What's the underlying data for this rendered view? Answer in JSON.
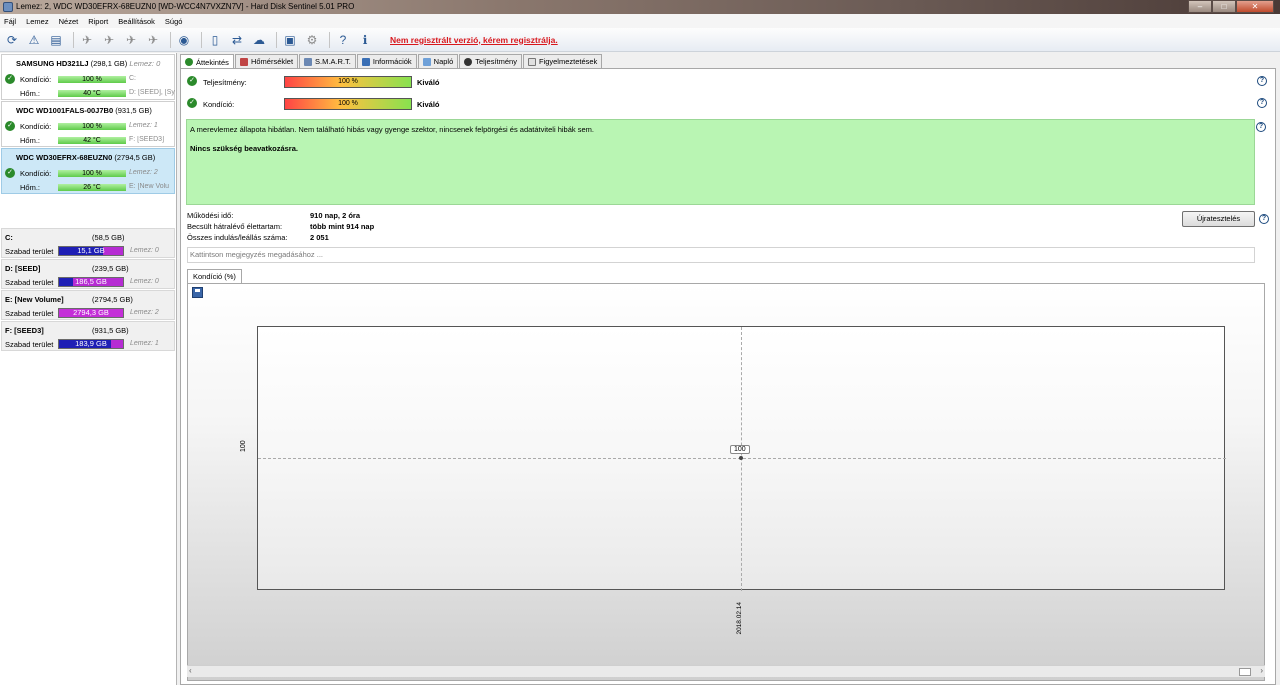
{
  "window": {
    "title": "Lemez: 2, WDC WD30EFRX-68EUZN0 [WD-WCC4N7VXZN7V]  -  Hard Disk Sentinel 5.01 PRO",
    "buttons": [
      "–",
      "□",
      "✕"
    ]
  },
  "menu": [
    "Fájl",
    "Lemez",
    "Nézet",
    "Riport",
    "Beállítások",
    "Súgó"
  ],
  "toolbar": {
    "icons": [
      "refresh-icon",
      "warning-icon",
      "report-icon",
      "satellite-icon",
      "satellite-icon",
      "satellite-icon",
      "satellite-icon",
      "globe-icon",
      "document-icon",
      "sync-icon",
      "cloud-icon",
      "benchmark-icon",
      "settings-icon",
      "help-icon",
      "info-icon"
    ],
    "register_text": "Nem regisztrált verzió, kérem regisztrálja."
  },
  "disks": [
    {
      "name": "SAMSUNG HD321LJ",
      "size": "(298,1 GB)",
      "note": "Lemez: 0",
      "condition_label": "Kondíció:",
      "condition": "100 %",
      "condition_side": "C:",
      "temp_label": "Hőm.:",
      "temp": "40 °C",
      "temp_side": "D: [SEED], [Sy"
    },
    {
      "name": "WDC WD1001FALS-00J7B0",
      "size": "(931,5 GB)",
      "note": "",
      "condition_label": "Kondíció:",
      "condition": "100 %",
      "condition_side": "Lemez: 1",
      "temp_label": "Hőm.:",
      "temp": "42 °C",
      "temp_side": "F: [SEED3]"
    },
    {
      "name": "WDC WD30EFRX-68EUZN0",
      "size": "(2794,5 GB)",
      "note": "",
      "condition_label": "Kondíció:",
      "condition": "100 %",
      "condition_side": "Lemez: 2",
      "temp_label": "Hőm.:",
      "temp": "26 °C",
      "temp_side": "E: [New Volu"
    }
  ],
  "volumes": [
    {
      "name": "C:",
      "size": "(58,5 GB)",
      "free_label": "Szabad terület",
      "free": "15,1 GB",
      "free_pct": 0.26,
      "note": "Lemez: 0"
    },
    {
      "name": "D: [SEED]",
      "size": "(239,5 GB)",
      "free_label": "Szabad terület",
      "free": "186,5 GB",
      "free_pct": 0.78,
      "note": "Lemez: 0"
    },
    {
      "name": "E: [New Volume]",
      "size": "(2794,5 GB)",
      "free_label": "Szabad terület",
      "free": "2794,3 GB",
      "free_pct": 1.0,
      "note": "Lemez: 2"
    },
    {
      "name": "F: [SEED3]",
      "size": "(931,5 GB)",
      "free_label": "Szabad terület",
      "free": "183,9 GB",
      "free_pct": 0.2,
      "note": "Lemez: 1"
    }
  ],
  "tabs": [
    "Áttekintés",
    "Hőmérséklet",
    "S.M.A.R.T.",
    "Információk",
    "Napló",
    "Teljesítmény",
    "Figyelmeztetések"
  ],
  "overview": {
    "performance_label": "Teljesítmény:",
    "performance_value": "100 %",
    "performance_status": "Kiváló",
    "condition_label": "Kondíció:",
    "condition_value": "100 %",
    "condition_status": "Kiváló",
    "status_text": "A merevlemez állapota hibátlan. Nem található hibás vagy gyenge szektor, nincsenek felpörgési és adatátviteli hibák sem.",
    "recommendation": "Nincs szükség beavatkozásra.",
    "uptime_label": "Működési idő:",
    "uptime_value": "910 nap, 2 óra",
    "remaining_label": "Becsült hátralévő élettartam:",
    "remaining_value": "több mint 914 nap",
    "startstop_label": "Összes indulás/leállás száma:",
    "startstop_value": "2 051",
    "retest_button": "Újratesztelés",
    "note_placeholder": "Kattintson megjegyzés megadásához ...",
    "help_icon": "?"
  },
  "chart_tab": "Kondíció  (%)",
  "chart_data": {
    "type": "line",
    "title": "",
    "xlabel": "",
    "ylabel": "",
    "x": [
      "2018.02.14"
    ],
    "series": [
      {
        "values": [
          100
        ]
      }
    ],
    "ytick": "100",
    "point_label": "100",
    "grid": true
  }
}
